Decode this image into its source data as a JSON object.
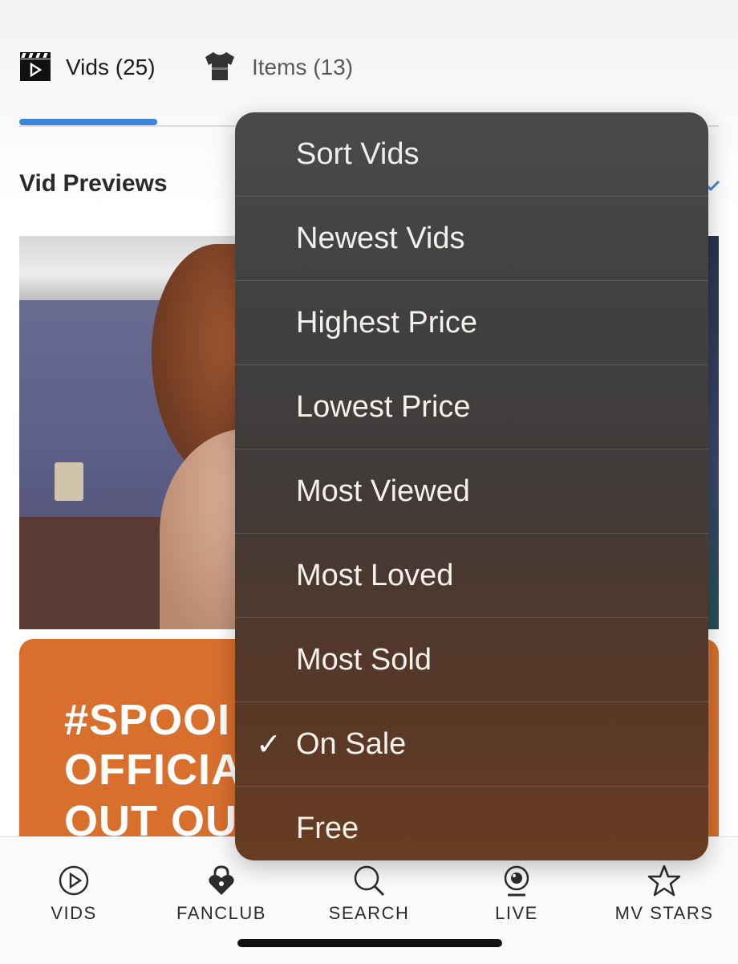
{
  "tabs": [
    {
      "label": "Vids (25)",
      "icon": "clapperboard-icon",
      "active": true
    },
    {
      "label": "Items (13)",
      "icon": "tshirt-icon",
      "active": false
    }
  ],
  "section": {
    "title": "Vid Previews"
  },
  "promo": {
    "lines": [
      "#SPOOI",
      "OFFICIA",
      "OUT OU"
    ]
  },
  "sort_menu": {
    "header": "Sort Vids",
    "options": [
      {
        "label": "Newest Vids",
        "selected": false
      },
      {
        "label": "Highest Price",
        "selected": false
      },
      {
        "label": "Lowest Price",
        "selected": false
      },
      {
        "label": "Most Viewed",
        "selected": false
      },
      {
        "label": "Most Loved",
        "selected": false
      },
      {
        "label": "Most Sold",
        "selected": false
      },
      {
        "label": "On Sale",
        "selected": true,
        "check": "✓"
      },
      {
        "label": "Free",
        "selected": false
      }
    ]
  },
  "bottom_nav": [
    {
      "label": "VIDS",
      "icon": "play-circle-icon"
    },
    {
      "label": "FANCLUB",
      "icon": "lock-heart-icon"
    },
    {
      "label": "SEARCH",
      "icon": "search-icon"
    },
    {
      "label": "LIVE",
      "icon": "live-webcam-icon"
    },
    {
      "label": "MV STARS",
      "icon": "star-icon"
    }
  ],
  "colors": {
    "accent": "#3d86de",
    "promo_bg": "#d96f2d"
  }
}
